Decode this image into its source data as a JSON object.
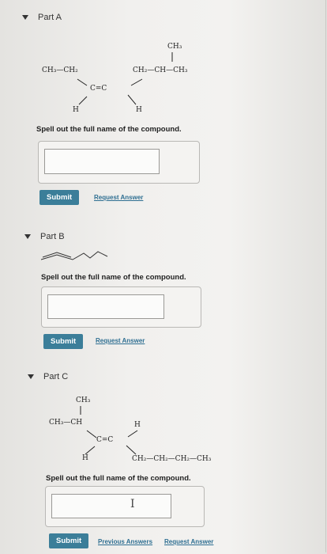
{
  "partA": {
    "title": "Part A",
    "labels": {
      "ch3_top": "CH₃",
      "ch3_ch2": "CH₃—CH₂",
      "ch2_ch_ch3": "CH₂—CH—CH₃",
      "c_eq_c": "C=C",
      "h_left": "H",
      "h_right": "H"
    },
    "question": "Spell out the full name of the compound.",
    "answer_value": "",
    "submit": "Submit",
    "request": "Request Answer"
  },
  "partB": {
    "title": "Part B",
    "question": "Spell out the full name of the compound.",
    "answer_value": "",
    "submit": "Submit",
    "request": "Request Answer"
  },
  "partC": {
    "title": "Part C",
    "labels": {
      "ch3_top": "CH₃",
      "ch3_ch": "CH₃—CH",
      "h_top": "H",
      "c_eq_c": "C=C",
      "h_bottom": "H",
      "chain": "CH₂—CH₂—CH₂—CH₃"
    },
    "question": "Spell out the full name of the compound.",
    "answer_value": "",
    "cursor": "I",
    "submit": "Submit",
    "previous": "Previous Answers",
    "request": "Request Answer"
  }
}
